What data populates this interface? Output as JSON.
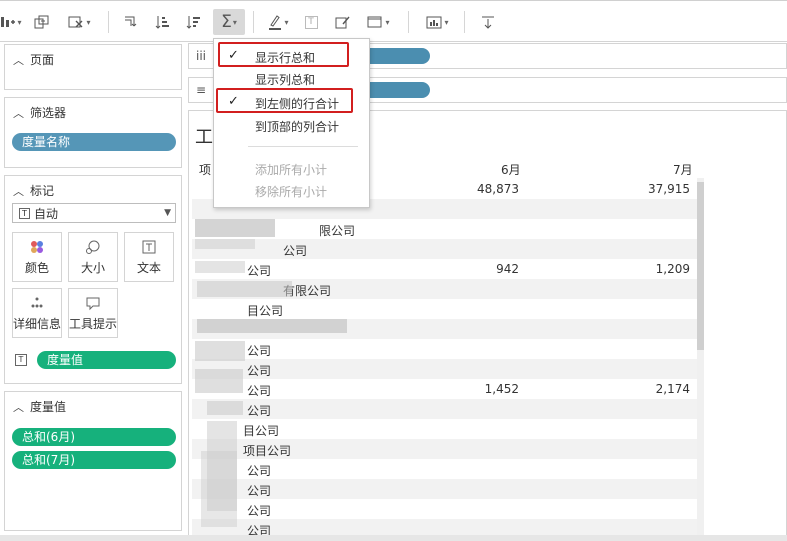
{
  "toolbar": {
    "buttons": [
      {
        "icon": "show-mark-labels-icon"
      },
      {
        "icon": "group-members-icon"
      },
      {
        "icon": "clear-sheet-icon"
      },
      {
        "icon": "swap-rows-columns-icon"
      },
      {
        "icon": "sort-ascending-icon"
      },
      {
        "icon": "sort-descending-icon"
      },
      {
        "icon": "totals-sigma-icon"
      },
      {
        "icon": "highlight-pen-icon"
      },
      {
        "icon": "text-labels-icon"
      },
      {
        "icon": "annotate-icon"
      },
      {
        "icon": "fit-view-icon"
      },
      {
        "icon": "show-me-icon"
      },
      {
        "icon": "download-icon"
      }
    ]
  },
  "left_panel": {
    "pages": {
      "title": "页面"
    },
    "filters": {
      "title": "筛选器",
      "pill": "度量名称"
    },
    "marks": {
      "title": "标记",
      "mark_type": "自动",
      "buttons": {
        "color": "颜色",
        "size": "大小",
        "text": "文本",
        "detail": "详细信息",
        "tooltip": "工具提示"
      },
      "text_pill": "度量值"
    },
    "measure_values": {
      "title": "度量值",
      "pills": [
        "总和(6月)",
        "总和(7月)"
      ]
    }
  },
  "shelves": {
    "columns_icon": "iii",
    "rows_icon": "≡"
  },
  "sheet": {
    "title": "工",
    "headers": {
      "item": "项",
      "june": "6月",
      "july": "7月"
    },
    "rows": [
      {
        "name": "",
        "june": "48,873",
        "july": "37,915"
      },
      {
        "name": "",
        "june": "",
        "july": ""
      },
      {
        "name": "限公司",
        "june": "",
        "july": ""
      },
      {
        "name": "公司",
        "june": "",
        "july": ""
      },
      {
        "name": "公司",
        "june": "942",
        "july": "1,209"
      },
      {
        "name": "有限公司",
        "june": "",
        "july": ""
      },
      {
        "name": "目公司",
        "june": "",
        "july": ""
      },
      {
        "name": "",
        "june": "",
        "july": ""
      },
      {
        "name": "公司",
        "june": "",
        "july": ""
      },
      {
        "name": "公司",
        "june": "",
        "july": ""
      },
      {
        "name": "公司",
        "june": "1,452",
        "july": "2,174"
      },
      {
        "name": "公司",
        "june": "",
        "july": ""
      },
      {
        "name": "目公司",
        "june": "",
        "july": ""
      },
      {
        "name": "项目公司",
        "june": "",
        "july": ""
      },
      {
        "name": "公司",
        "june": "",
        "july": ""
      },
      {
        "name": "公司",
        "june": "",
        "july": ""
      },
      {
        "name": "公司",
        "june": "",
        "july": ""
      },
      {
        "name": "公司",
        "june": "",
        "july": ""
      }
    ]
  },
  "totals_menu": {
    "items": [
      {
        "label": "显示行总和",
        "checked": true,
        "enabled": true
      },
      {
        "label": "显示列总和",
        "checked": false,
        "enabled": true
      },
      {
        "label": "到左侧的行合计",
        "checked": true,
        "enabled": true
      },
      {
        "label": "到顶部的列合计",
        "checked": false,
        "enabled": true
      },
      {
        "label": "添加所有小计",
        "checked": false,
        "enabled": false
      },
      {
        "label": "移除所有小计",
        "checked": false,
        "enabled": false
      }
    ],
    "checkmark": "✓",
    "highlight_color": "#d21f1f"
  },
  "colors": {
    "filter_pill": "#5596b7",
    "measure_pill": "#16b17c",
    "shelf_pill": "#4b8eb0"
  }
}
